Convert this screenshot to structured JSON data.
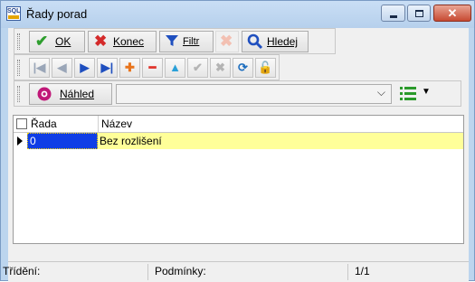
{
  "window": {
    "title": "Řady porad",
    "app_icon_text": "SQL",
    "controls": {
      "minimize": "minimize-icon",
      "maximize": "maximize-icon",
      "close": "✕"
    }
  },
  "toolbar_main": {
    "ok": {
      "label": "OK",
      "icon": "check-icon",
      "color": "#2e9e2e"
    },
    "konec": {
      "label": "Konec",
      "icon": "x-icon",
      "color": "#d42a2a"
    },
    "filtr": {
      "label": "Filtr",
      "icon": "funnel-icon",
      "color": "#1f4fbf"
    },
    "clear_filter": {
      "icon": "clear-filter-icon"
    },
    "hledej": {
      "label": "Hledej",
      "icon": "magnifier-icon",
      "color": "#1f4fbf"
    }
  },
  "toolbar_nav": {
    "buttons": [
      {
        "name": "nav-first-button",
        "glyph": "|◀",
        "color": "#9aa6b8"
      },
      {
        "name": "nav-prior-button",
        "glyph": "◀",
        "color": "#9aa6b8"
      },
      {
        "name": "nav-next-button",
        "glyph": "▶",
        "color": "#1f4fbf"
      },
      {
        "name": "nav-last-button",
        "glyph": "▶|",
        "color": "#1f4fbf"
      },
      {
        "name": "nav-insert-button",
        "glyph": "✚",
        "color": "#e8741c"
      },
      {
        "name": "nav-delete-button",
        "glyph": "━",
        "color": "#e0322a"
      },
      {
        "name": "nav-edit-button",
        "glyph": "▲",
        "color": "#2aa0d8"
      },
      {
        "name": "nav-post-button",
        "glyph": "✔",
        "color": "#b4b4b4"
      },
      {
        "name": "nav-cancel-button",
        "glyph": "✖",
        "color": "#b4b4b4"
      },
      {
        "name": "nav-refresh-button",
        "glyph": "⟳",
        "color": "#1f6fbf"
      },
      {
        "name": "nav-lock-button",
        "glyph": "🔓",
        "color": "#2e9e2e"
      }
    ]
  },
  "toolbar_preview": {
    "nahled": {
      "label": "Náhled",
      "icon": "eye-icon",
      "color": "#c01878"
    },
    "combo_value": "",
    "combo_arrow": "⌵",
    "list_icon": "list-icon",
    "caret": "▼"
  },
  "grid": {
    "columns": [
      "Řada",
      "Název"
    ],
    "rows": [
      {
        "rada": "0",
        "nazev": "Bez rozlišení"
      }
    ]
  },
  "statusbar": {
    "trideni_label": "Třídění:",
    "podminky_label": "Podmínky:",
    "position": "1/1"
  },
  "colors": {
    "selected_cell": "#0f3ee6",
    "row_highlight": "#ffff99",
    "title_bar": "#bcd5ee"
  }
}
